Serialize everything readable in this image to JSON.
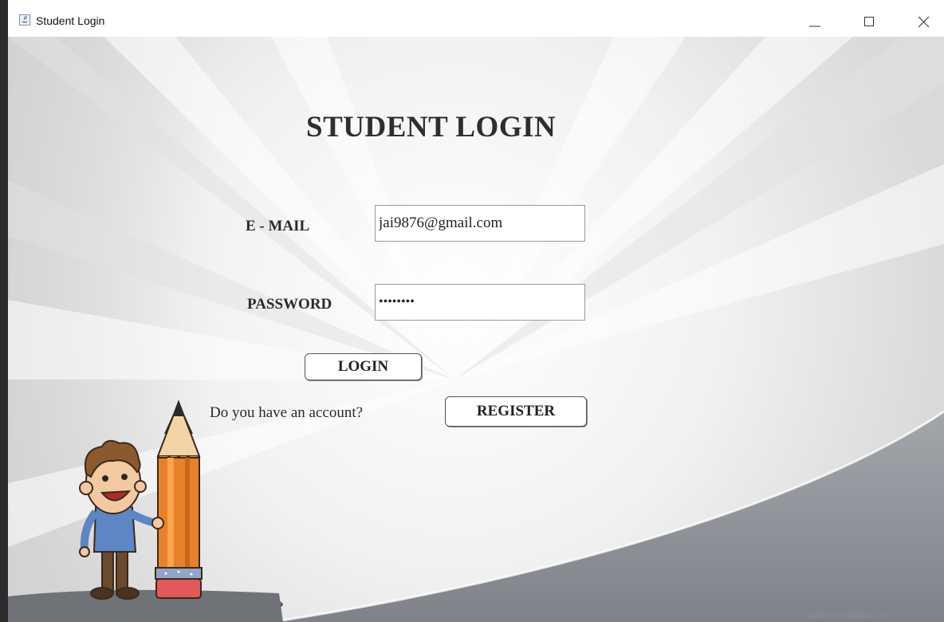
{
  "window": {
    "title": "Student Login",
    "app_icon": "java-app-icon",
    "controls": [
      "minimize-icon",
      "maximize-icon",
      "close-icon"
    ]
  },
  "form": {
    "heading": "STUDENT LOGIN",
    "email_label": "E - MAIL",
    "email_value": "jai9876@gmail.com",
    "password_label": "PASSWORD",
    "password_value": "••••••••",
    "login_label": "LOGIN",
    "account_prompt": "Do you have an account?",
    "register_label": "REGISTER"
  },
  "footer": {
    "watermark": "powered by pxlbeck.com"
  },
  "colors": {
    "background_light": "#f4f4f4",
    "background_swoosh": "#8c8f94",
    "pencil_body": "#e07b22",
    "text": "#2e2e2e"
  }
}
